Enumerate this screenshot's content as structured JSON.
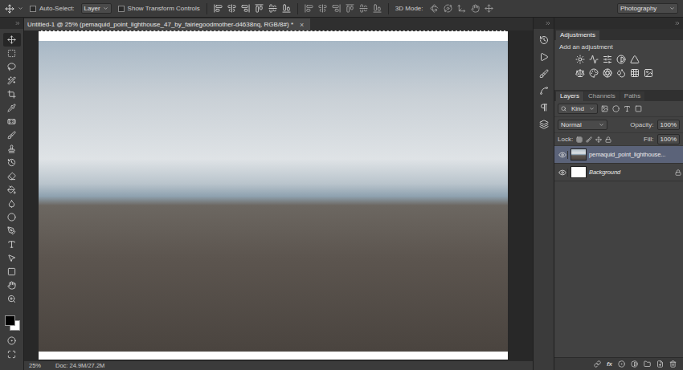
{
  "options_bar": {
    "auto_select": {
      "label": "Auto-Select:",
      "checked": false
    },
    "target": "Layer",
    "transform": {
      "label": "Show Transform Controls",
      "checked": false
    },
    "mode_label": "3D Mode:",
    "workspace": "Photography"
  },
  "tools": [
    {
      "selected": true
    },
    {
      "selected": false
    },
    {
      "selected": false
    },
    {
      "selected": false
    },
    {
      "selected": false
    },
    {
      "selected": false
    },
    {
      "selected": false
    },
    {
      "selected": false
    },
    {
      "selected": false
    },
    {
      "selected": false
    },
    {
      "selected": false
    },
    {
      "selected": false
    },
    {
      "selected": false
    },
    {
      "selected": false
    },
    {
      "selected": false
    },
    {
      "selected": false
    },
    {
      "selected": false
    },
    {
      "selected": false
    },
    {
      "selected": false
    },
    {
      "selected": false
    }
  ],
  "document": {
    "title": "Untitled-1 @ 25% (pemaquid_point_lighthouse_47_by_fairiegoodmother-d4638nq, RGB/8#) *",
    "close": "×"
  },
  "status_bar": {
    "zoom": "25%",
    "doc": "Doc: 24.9M/27.2M"
  },
  "adjustments": {
    "title": "Adjustments",
    "subtitle": "Add an adjustment"
  },
  "layers_panel": {
    "tabs": [
      {
        "label": "Layers",
        "selected": true
      },
      {
        "label": "Channels",
        "selected": false
      },
      {
        "label": "Paths",
        "selected": false
      }
    ],
    "filter": "Kind",
    "blend_mode": "Normal",
    "opacity_label": "Opacity:",
    "opacity": "100%",
    "lock_label": "Lock:",
    "fill_label": "Fill:",
    "fill": "100%",
    "layers": [
      {
        "name": "pemaquid_point_lighthouse...",
        "visible": true,
        "selected": true,
        "locked": false,
        "kind": "photo"
      },
      {
        "name": "Background",
        "visible": true,
        "selected": false,
        "locked": true,
        "kind": "white"
      }
    ],
    "footer_fx": "fx"
  }
}
